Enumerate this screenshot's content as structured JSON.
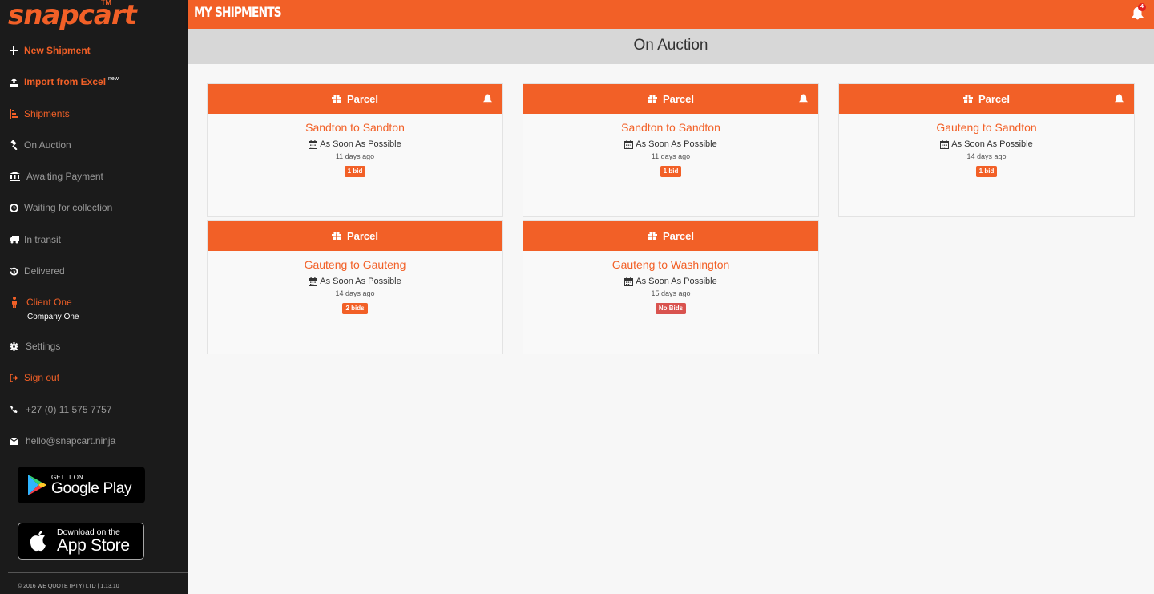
{
  "brand": {
    "name": "snapcart",
    "tm": "TM"
  },
  "header": {
    "title": "MY SHIPMENTS",
    "notification_count": "4"
  },
  "subheader": {
    "title": "On Auction"
  },
  "sidebar": {
    "items": [
      {
        "label": "New Shipment",
        "icon": "plus-icon"
      },
      {
        "label": "Import from Excel",
        "badge": "new",
        "icon": "upload-icon"
      },
      {
        "label": "Shipments",
        "icon": "list-icon"
      },
      {
        "label": "On Auction",
        "icon": "gavel-icon"
      },
      {
        "label": "Awaiting Payment",
        "icon": "bank-icon"
      },
      {
        "label": "Waiting for collection",
        "icon": "clock-icon"
      },
      {
        "label": "In transit",
        "icon": "truck-icon"
      },
      {
        "label": "Delivered",
        "icon": "history-icon"
      }
    ],
    "client": {
      "name": "Client One",
      "company": "Company One"
    },
    "settings": "Settings",
    "signout": "Sign out",
    "phone": "+27 (0) 11 575 7757",
    "email": "hello@snapcart.ninja",
    "google_play": {
      "small": "GET IT ON",
      "big": "Google Play"
    },
    "app_store": {
      "small": "Download on the",
      "big": "App Store"
    },
    "copyright": "© 2016 WE QUOTE (PTY) LTD | 1.13.10"
  },
  "cards": [
    {
      "type": "Parcel",
      "route": "Sandton to Sandton",
      "timing": "As Soon As Possible",
      "ago": "11 days ago",
      "bids": "1 bid",
      "has_bell": true
    },
    {
      "type": "Parcel",
      "route": "Sandton to Sandton",
      "timing": "As Soon As Possible",
      "ago": "11 days ago",
      "bids": "1 bid",
      "has_bell": true
    },
    {
      "type": "Parcel",
      "route": "Gauteng to Sandton",
      "timing": "As Soon As Possible",
      "ago": "14 days ago",
      "bids": "1 bid",
      "has_bell": true
    },
    {
      "type": "Parcel",
      "route": "Gauteng to Gauteng",
      "timing": "As Soon As Possible",
      "ago": "14 days ago",
      "bids": "2 bids",
      "has_bell": false
    },
    {
      "type": "Parcel",
      "route": "Gauteng to Washington",
      "timing": "As Soon As Possible",
      "ago": "15 days ago",
      "bids": "No Bids",
      "has_bell": false
    }
  ],
  "colors": {
    "accent": "#f26027",
    "sidebar_bg": "#1b1b1b",
    "no_bids": "#d9534f"
  }
}
